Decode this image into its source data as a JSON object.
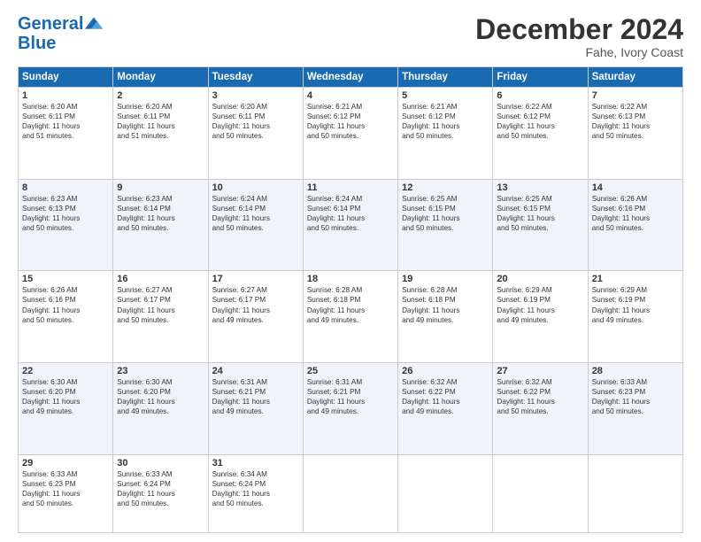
{
  "header": {
    "logo_line1": "General",
    "logo_line2": "Blue",
    "month": "December 2024",
    "location": "Fahe, Ivory Coast"
  },
  "weekdays": [
    "Sunday",
    "Monday",
    "Tuesday",
    "Wednesday",
    "Thursday",
    "Friday",
    "Saturday"
  ],
  "weeks": [
    [
      {
        "day": "1",
        "lines": [
          "Sunrise: 6:20 AM",
          "Sunset: 6:11 PM",
          "Daylight: 11 hours",
          "and 51 minutes."
        ]
      },
      {
        "day": "2",
        "lines": [
          "Sunrise: 6:20 AM",
          "Sunset: 6:11 PM",
          "Daylight: 11 hours",
          "and 51 minutes."
        ]
      },
      {
        "day": "3",
        "lines": [
          "Sunrise: 6:20 AM",
          "Sunset: 6:11 PM",
          "Daylight: 11 hours",
          "and 50 minutes."
        ]
      },
      {
        "day": "4",
        "lines": [
          "Sunrise: 6:21 AM",
          "Sunset: 6:12 PM",
          "Daylight: 11 hours",
          "and 50 minutes."
        ]
      },
      {
        "day": "5",
        "lines": [
          "Sunrise: 6:21 AM",
          "Sunset: 6:12 PM",
          "Daylight: 11 hours",
          "and 50 minutes."
        ]
      },
      {
        "day": "6",
        "lines": [
          "Sunrise: 6:22 AM",
          "Sunset: 6:12 PM",
          "Daylight: 11 hours",
          "and 50 minutes."
        ]
      },
      {
        "day": "7",
        "lines": [
          "Sunrise: 6:22 AM",
          "Sunset: 6:13 PM",
          "Daylight: 11 hours",
          "and 50 minutes."
        ]
      }
    ],
    [
      {
        "day": "8",
        "lines": [
          "Sunrise: 6:23 AM",
          "Sunset: 6:13 PM",
          "Daylight: 11 hours",
          "and 50 minutes."
        ]
      },
      {
        "day": "9",
        "lines": [
          "Sunrise: 6:23 AM",
          "Sunset: 6:14 PM",
          "Daylight: 11 hours",
          "and 50 minutes."
        ]
      },
      {
        "day": "10",
        "lines": [
          "Sunrise: 6:24 AM",
          "Sunset: 6:14 PM",
          "Daylight: 11 hours",
          "and 50 minutes."
        ]
      },
      {
        "day": "11",
        "lines": [
          "Sunrise: 6:24 AM",
          "Sunset: 6:14 PM",
          "Daylight: 11 hours",
          "and 50 minutes."
        ]
      },
      {
        "day": "12",
        "lines": [
          "Sunrise: 6:25 AM",
          "Sunset: 6:15 PM",
          "Daylight: 11 hours",
          "and 50 minutes."
        ]
      },
      {
        "day": "13",
        "lines": [
          "Sunrise: 6:25 AM",
          "Sunset: 6:15 PM",
          "Daylight: 11 hours",
          "and 50 minutes."
        ]
      },
      {
        "day": "14",
        "lines": [
          "Sunrise: 6:26 AM",
          "Sunset: 6:16 PM",
          "Daylight: 11 hours",
          "and 50 minutes."
        ]
      }
    ],
    [
      {
        "day": "15",
        "lines": [
          "Sunrise: 6:26 AM",
          "Sunset: 6:16 PM",
          "Daylight: 11 hours",
          "and 50 minutes."
        ]
      },
      {
        "day": "16",
        "lines": [
          "Sunrise: 6:27 AM",
          "Sunset: 6:17 PM",
          "Daylight: 11 hours",
          "and 50 minutes."
        ]
      },
      {
        "day": "17",
        "lines": [
          "Sunrise: 6:27 AM",
          "Sunset: 6:17 PM",
          "Daylight: 11 hours",
          "and 49 minutes."
        ]
      },
      {
        "day": "18",
        "lines": [
          "Sunrise: 6:28 AM",
          "Sunset: 6:18 PM",
          "Daylight: 11 hours",
          "and 49 minutes."
        ]
      },
      {
        "day": "19",
        "lines": [
          "Sunrise: 6:28 AM",
          "Sunset: 6:18 PM",
          "Daylight: 11 hours",
          "and 49 minutes."
        ]
      },
      {
        "day": "20",
        "lines": [
          "Sunrise: 6:29 AM",
          "Sunset: 6:19 PM",
          "Daylight: 11 hours",
          "and 49 minutes."
        ]
      },
      {
        "day": "21",
        "lines": [
          "Sunrise: 6:29 AM",
          "Sunset: 6:19 PM",
          "Daylight: 11 hours",
          "and 49 minutes."
        ]
      }
    ],
    [
      {
        "day": "22",
        "lines": [
          "Sunrise: 6:30 AM",
          "Sunset: 6:20 PM",
          "Daylight: 11 hours",
          "and 49 minutes."
        ]
      },
      {
        "day": "23",
        "lines": [
          "Sunrise: 6:30 AM",
          "Sunset: 6:20 PM",
          "Daylight: 11 hours",
          "and 49 minutes."
        ]
      },
      {
        "day": "24",
        "lines": [
          "Sunrise: 6:31 AM",
          "Sunset: 6:21 PM",
          "Daylight: 11 hours",
          "and 49 minutes."
        ]
      },
      {
        "day": "25",
        "lines": [
          "Sunrise: 6:31 AM",
          "Sunset: 6:21 PM",
          "Daylight: 11 hours",
          "and 49 minutes."
        ]
      },
      {
        "day": "26",
        "lines": [
          "Sunrise: 6:32 AM",
          "Sunset: 6:22 PM",
          "Daylight: 11 hours",
          "and 49 minutes."
        ]
      },
      {
        "day": "27",
        "lines": [
          "Sunrise: 6:32 AM",
          "Sunset: 6:22 PM",
          "Daylight: 11 hours",
          "and 50 minutes."
        ]
      },
      {
        "day": "28",
        "lines": [
          "Sunrise: 6:33 AM",
          "Sunset: 6:23 PM",
          "Daylight: 11 hours",
          "and 50 minutes."
        ]
      }
    ],
    [
      {
        "day": "29",
        "lines": [
          "Sunrise: 6:33 AM",
          "Sunset: 6:23 PM",
          "Daylight: 11 hours",
          "and 50 minutes."
        ]
      },
      {
        "day": "30",
        "lines": [
          "Sunrise: 6:33 AM",
          "Sunset: 6:24 PM",
          "Daylight: 11 hours",
          "and 50 minutes."
        ]
      },
      {
        "day": "31",
        "lines": [
          "Sunrise: 6:34 AM",
          "Sunset: 6:24 PM",
          "Daylight: 11 hours",
          "and 50 minutes."
        ]
      },
      null,
      null,
      null,
      null
    ]
  ]
}
